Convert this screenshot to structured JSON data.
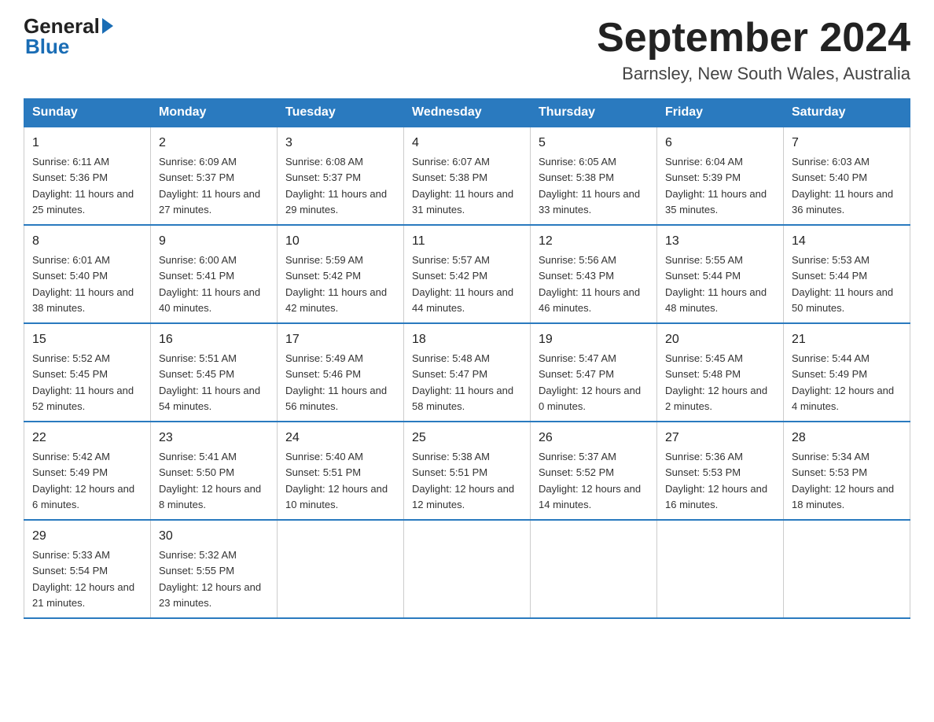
{
  "logo": {
    "general": "General",
    "blue": "Blue"
  },
  "title": "September 2024",
  "subtitle": "Barnsley, New South Wales, Australia",
  "days_of_week": [
    "Sunday",
    "Monday",
    "Tuesday",
    "Wednesday",
    "Thursday",
    "Friday",
    "Saturday"
  ],
  "weeks": [
    [
      {
        "day": "1",
        "sunrise": "6:11 AM",
        "sunset": "5:36 PM",
        "daylight": "11 hours and 25 minutes."
      },
      {
        "day": "2",
        "sunrise": "6:09 AM",
        "sunset": "5:37 PM",
        "daylight": "11 hours and 27 minutes."
      },
      {
        "day": "3",
        "sunrise": "6:08 AM",
        "sunset": "5:37 PM",
        "daylight": "11 hours and 29 minutes."
      },
      {
        "day": "4",
        "sunrise": "6:07 AM",
        "sunset": "5:38 PM",
        "daylight": "11 hours and 31 minutes."
      },
      {
        "day": "5",
        "sunrise": "6:05 AM",
        "sunset": "5:38 PM",
        "daylight": "11 hours and 33 minutes."
      },
      {
        "day": "6",
        "sunrise": "6:04 AM",
        "sunset": "5:39 PM",
        "daylight": "11 hours and 35 minutes."
      },
      {
        "day": "7",
        "sunrise": "6:03 AM",
        "sunset": "5:40 PM",
        "daylight": "11 hours and 36 minutes."
      }
    ],
    [
      {
        "day": "8",
        "sunrise": "6:01 AM",
        "sunset": "5:40 PM",
        "daylight": "11 hours and 38 minutes."
      },
      {
        "day": "9",
        "sunrise": "6:00 AM",
        "sunset": "5:41 PM",
        "daylight": "11 hours and 40 minutes."
      },
      {
        "day": "10",
        "sunrise": "5:59 AM",
        "sunset": "5:42 PM",
        "daylight": "11 hours and 42 minutes."
      },
      {
        "day": "11",
        "sunrise": "5:57 AM",
        "sunset": "5:42 PM",
        "daylight": "11 hours and 44 minutes."
      },
      {
        "day": "12",
        "sunrise": "5:56 AM",
        "sunset": "5:43 PM",
        "daylight": "11 hours and 46 minutes."
      },
      {
        "day": "13",
        "sunrise": "5:55 AM",
        "sunset": "5:44 PM",
        "daylight": "11 hours and 48 minutes."
      },
      {
        "day": "14",
        "sunrise": "5:53 AM",
        "sunset": "5:44 PM",
        "daylight": "11 hours and 50 minutes."
      }
    ],
    [
      {
        "day": "15",
        "sunrise": "5:52 AM",
        "sunset": "5:45 PM",
        "daylight": "11 hours and 52 minutes."
      },
      {
        "day": "16",
        "sunrise": "5:51 AM",
        "sunset": "5:45 PM",
        "daylight": "11 hours and 54 minutes."
      },
      {
        "day": "17",
        "sunrise": "5:49 AM",
        "sunset": "5:46 PM",
        "daylight": "11 hours and 56 minutes."
      },
      {
        "day": "18",
        "sunrise": "5:48 AM",
        "sunset": "5:47 PM",
        "daylight": "11 hours and 58 minutes."
      },
      {
        "day": "19",
        "sunrise": "5:47 AM",
        "sunset": "5:47 PM",
        "daylight": "12 hours and 0 minutes."
      },
      {
        "day": "20",
        "sunrise": "5:45 AM",
        "sunset": "5:48 PM",
        "daylight": "12 hours and 2 minutes."
      },
      {
        "day": "21",
        "sunrise": "5:44 AM",
        "sunset": "5:49 PM",
        "daylight": "12 hours and 4 minutes."
      }
    ],
    [
      {
        "day": "22",
        "sunrise": "5:42 AM",
        "sunset": "5:49 PM",
        "daylight": "12 hours and 6 minutes."
      },
      {
        "day": "23",
        "sunrise": "5:41 AM",
        "sunset": "5:50 PM",
        "daylight": "12 hours and 8 minutes."
      },
      {
        "day": "24",
        "sunrise": "5:40 AM",
        "sunset": "5:51 PM",
        "daylight": "12 hours and 10 minutes."
      },
      {
        "day": "25",
        "sunrise": "5:38 AM",
        "sunset": "5:51 PM",
        "daylight": "12 hours and 12 minutes."
      },
      {
        "day": "26",
        "sunrise": "5:37 AM",
        "sunset": "5:52 PM",
        "daylight": "12 hours and 14 minutes."
      },
      {
        "day": "27",
        "sunrise": "5:36 AM",
        "sunset": "5:53 PM",
        "daylight": "12 hours and 16 minutes."
      },
      {
        "day": "28",
        "sunrise": "5:34 AM",
        "sunset": "5:53 PM",
        "daylight": "12 hours and 18 minutes."
      }
    ],
    [
      {
        "day": "29",
        "sunrise": "5:33 AM",
        "sunset": "5:54 PM",
        "daylight": "12 hours and 21 minutes."
      },
      {
        "day": "30",
        "sunrise": "5:32 AM",
        "sunset": "5:55 PM",
        "daylight": "12 hours and 23 minutes."
      },
      null,
      null,
      null,
      null,
      null
    ]
  ]
}
